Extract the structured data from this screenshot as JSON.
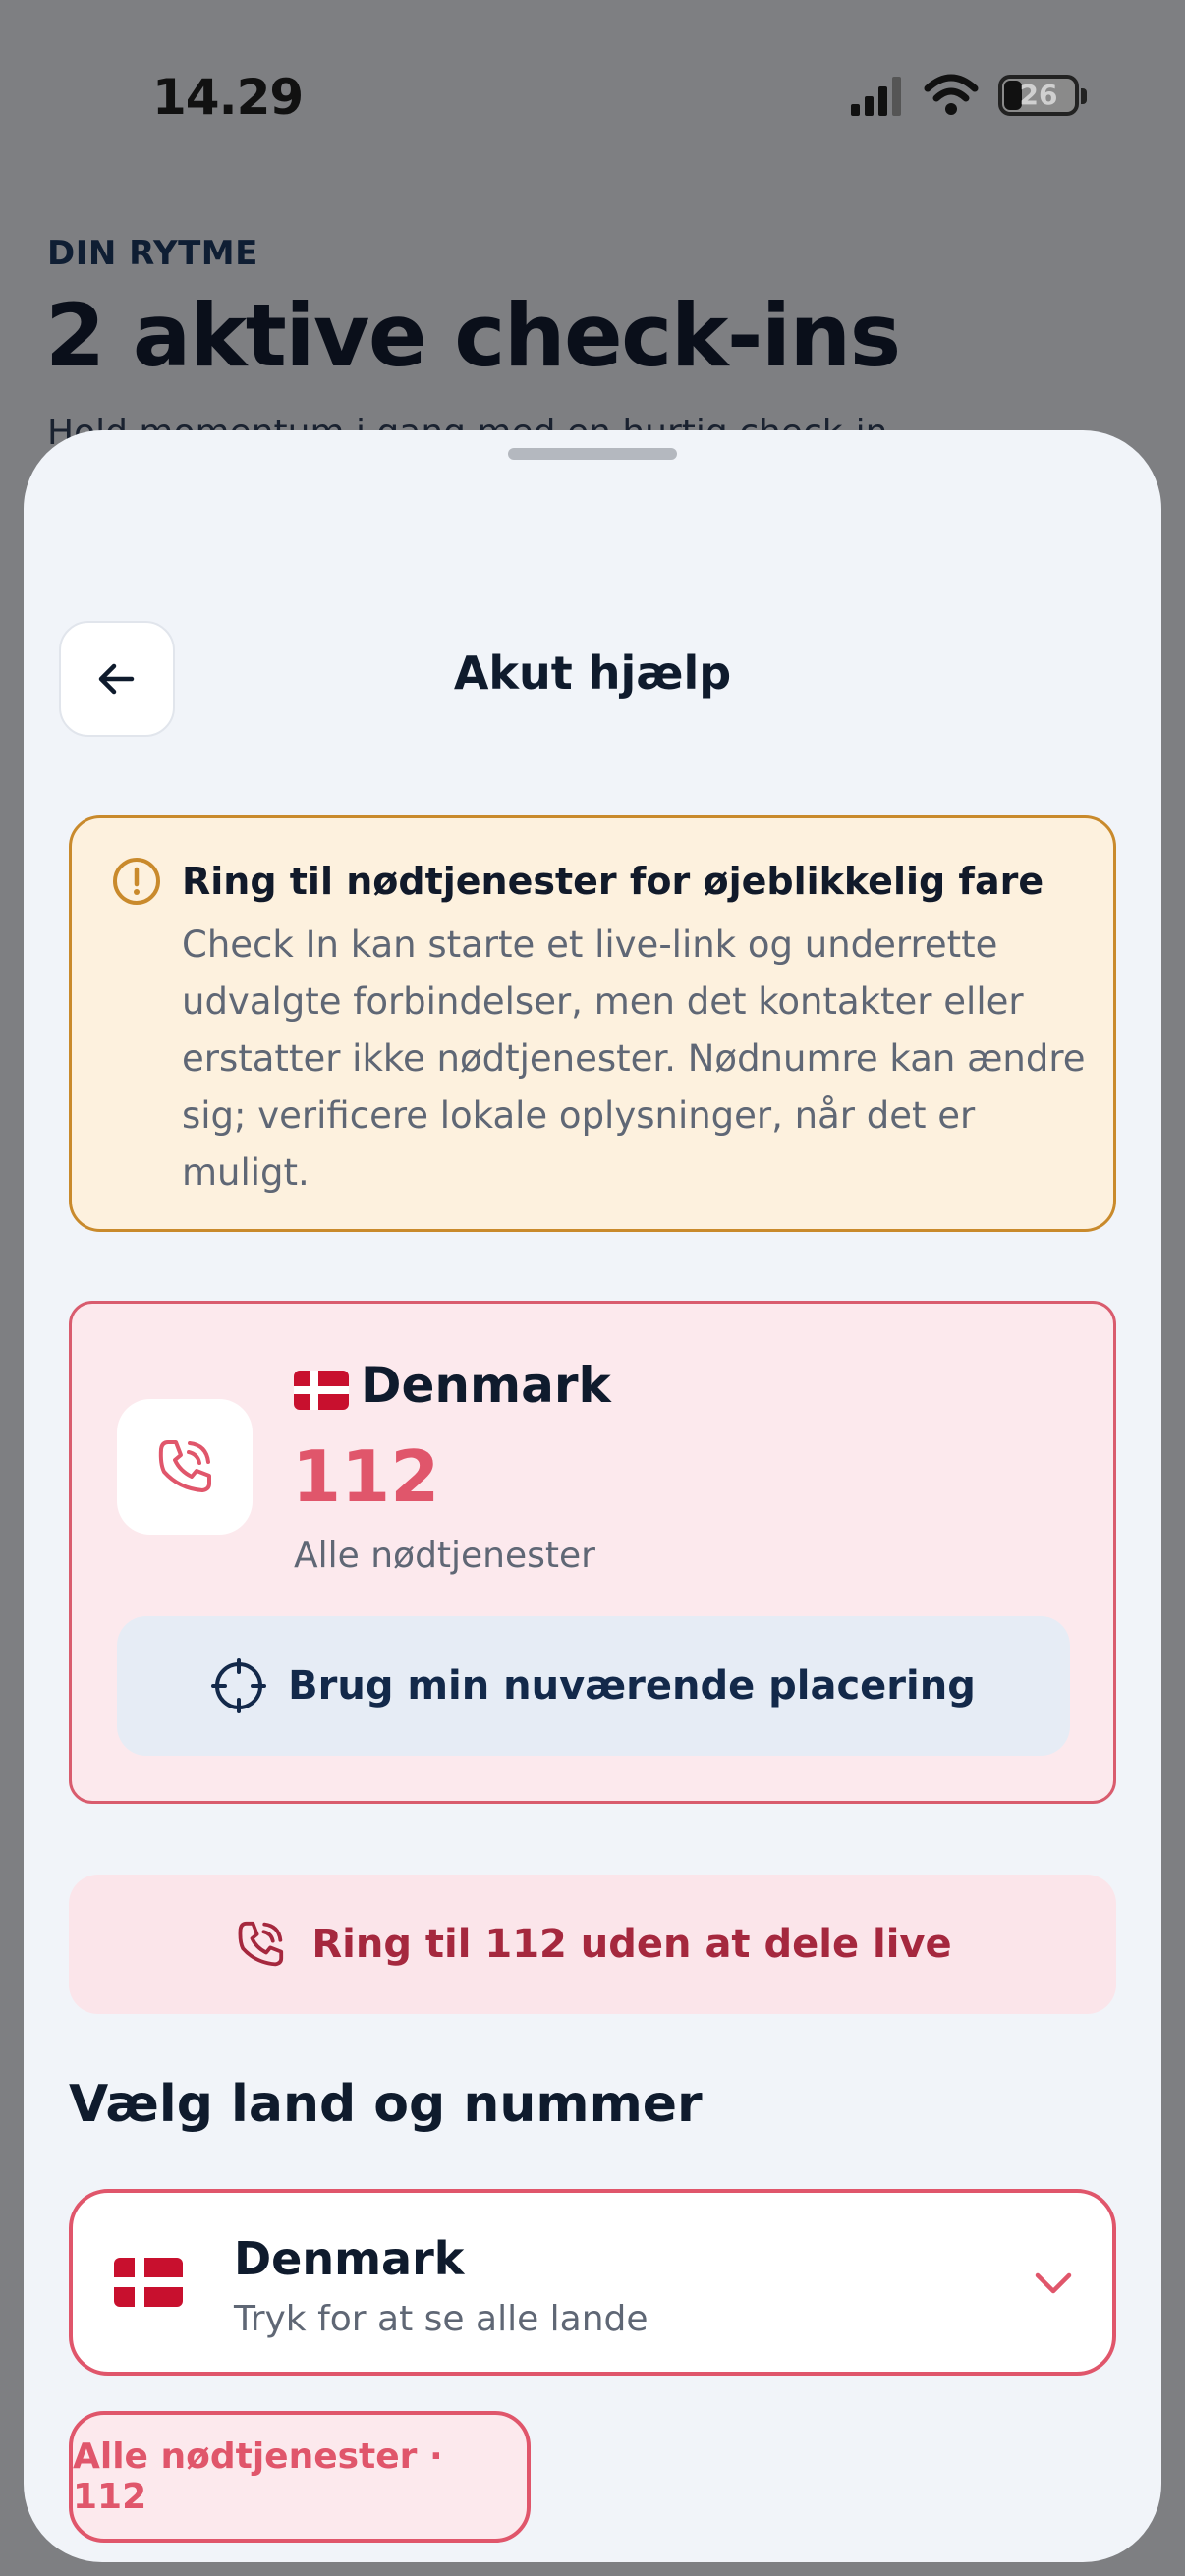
{
  "status_bar": {
    "time": "14.29",
    "battery_level": "26",
    "icons": [
      "cellular-signal-icon",
      "wifi-icon",
      "battery-icon"
    ]
  },
  "background_screen": {
    "eyebrow": "DIN RYTME",
    "title": "2 aktive check-ins",
    "subtitle": "Hold momentum i gang med en hurtig check-in"
  },
  "sheet": {
    "title": "Akut hjælp",
    "back_icon": "arrow-left-icon",
    "warning": {
      "heading": "Ring til nødtjenester for øjeblikkelig fare",
      "body": "Check In kan starte et live-link og underrette udvalgte forbindelser, men det kontakter eller erstatter ikke nødtjenester. Nødnumre kan ændre sig; verificere lokale oplysninger, når det er muligt.",
      "icon": "alert-circle-icon"
    },
    "emergency_card": {
      "country": "Denmark",
      "flag": "denmark-flag",
      "number": "112",
      "service": "Alle nødtjenester",
      "location_button_label": "Brug min nuværende placering",
      "icons": [
        "phone-call-icon",
        "crosshair-icon"
      ]
    },
    "call_button_label": "Ring til 112 uden at dele live",
    "section_heading": "Vælg land og nummer",
    "country_select": {
      "country": "Denmark",
      "hint": "Tryk for at se alle lande"
    },
    "number_chip": "Alle nødtjenester · 112"
  },
  "colors": {
    "accent_red": "#e0566b",
    "dark_red_text": "#a5283e",
    "warning_border": "#c98a2c",
    "warning_bg": "#fdf1de",
    "sheet_bg": "#f1f4f9",
    "navy_text": "#0f1b2d"
  }
}
